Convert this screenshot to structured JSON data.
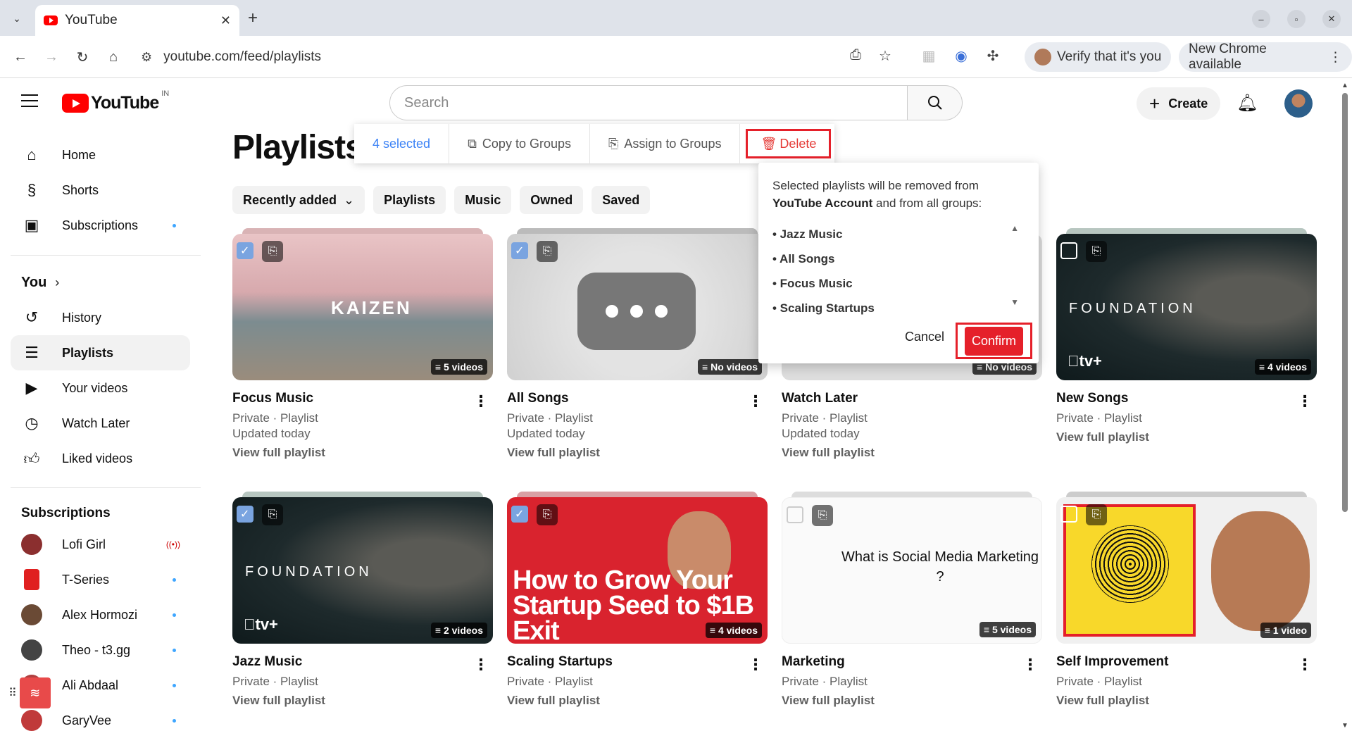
{
  "browser": {
    "tab_title": "YouTube",
    "url": "youtube.com/feed/playlists",
    "verify_label": "Verify that it's you",
    "update_label": "New Chrome available"
  },
  "header": {
    "logo": "YouTube",
    "country": "IN",
    "search_placeholder": "Search",
    "create_label": "Create"
  },
  "sidebar": {
    "main": [
      {
        "label": "Home",
        "icon": "home-icon"
      },
      {
        "label": "Shorts",
        "icon": "shorts-icon"
      },
      {
        "label": "Subscriptions",
        "icon": "subscriptions-icon"
      }
    ],
    "you_label": "You",
    "you_items": [
      {
        "label": "History",
        "icon": "history-icon"
      },
      {
        "label": "Playlists",
        "icon": "playlists-icon"
      },
      {
        "label": "Your videos",
        "icon": "your-videos-icon"
      },
      {
        "label": "Watch Later",
        "icon": "clock-icon"
      },
      {
        "label": "Liked videos",
        "icon": "thumbs-up-icon"
      }
    ],
    "subs_title": "Subscriptions",
    "subs": [
      {
        "label": "Lofi Girl",
        "color": "#8b2f2f"
      },
      {
        "label": "T-Series",
        "color": "#e02020"
      },
      {
        "label": "Alex Hormozi",
        "color": "#6a4a35"
      },
      {
        "label": "Theo - t3.gg",
        "color": "#444444"
      },
      {
        "label": "Ali Abdaal",
        "color": "#b04040"
      },
      {
        "label": "GaryVee",
        "color": "#c03a3a"
      }
    ]
  },
  "page": {
    "title": "Playlists",
    "chips": [
      "Recently added",
      "Playlists",
      "Music",
      "Owned",
      "Saved"
    ]
  },
  "selection_bar": {
    "count": "4 selected",
    "copy": "Copy to Groups",
    "assign": "Assign to Groups",
    "delete": "Delete"
  },
  "confirm_dialog": {
    "msg_pre": "Selected playlists will be removed from",
    "msg_bold": "YouTube Account",
    "msg_post": "and from all groups:",
    "items": [
      "• Jazz Music",
      "• All Songs",
      "• Focus Music",
      "• Scaling Startups"
    ],
    "cancel": "Cancel",
    "confirm": "Confirm"
  },
  "playlists": [
    {
      "title": "Focus Music",
      "meta1": "Private · Playlist",
      "meta2": "Updated today",
      "link": "View full playlist",
      "badge": "5 videos",
      "thumb_text": "KAIZEN",
      "selected": true
    },
    {
      "title": "All Songs",
      "meta1": "Private · Playlist",
      "meta2": "Updated today",
      "link": "View full playlist",
      "badge": "No videos",
      "selected": true
    },
    {
      "title": "Watch Later",
      "meta1": "Private · Playlist",
      "meta2": "Updated today",
      "link": "View full playlist",
      "badge": "No videos",
      "selected": false
    },
    {
      "title": "New Songs",
      "meta1": "Private · Playlist",
      "meta2": "",
      "link": "View full playlist",
      "badge": "4 videos",
      "thumb_text": "FOUNDATION",
      "thumb_sub": "tv+",
      "selected": false
    },
    {
      "title": "Jazz Music",
      "meta1": "Private · Playlist",
      "meta2": "",
      "link": "View full playlist",
      "badge": "2 videos",
      "thumb_text": "FOUNDATION",
      "thumb_sub": "tv+",
      "selected": true
    },
    {
      "title": "Scaling Startups",
      "meta1": "Private · Playlist",
      "meta2": "",
      "link": "View full playlist",
      "badge": "4 videos",
      "thumb_text": "How to Grow Your Startup Seed to $1B Exit",
      "selected": true
    },
    {
      "title": "Marketing",
      "meta1": "Private · Playlist",
      "meta2": "",
      "link": "View full playlist",
      "badge": "5 videos",
      "thumb_text": "What is Social Media Marketing ?",
      "selected": false
    },
    {
      "title": "Self Improvement",
      "meta1": "Private · Playlist",
      "meta2": "",
      "link": "View full playlist",
      "badge": "1 video",
      "selected": false
    }
  ]
}
